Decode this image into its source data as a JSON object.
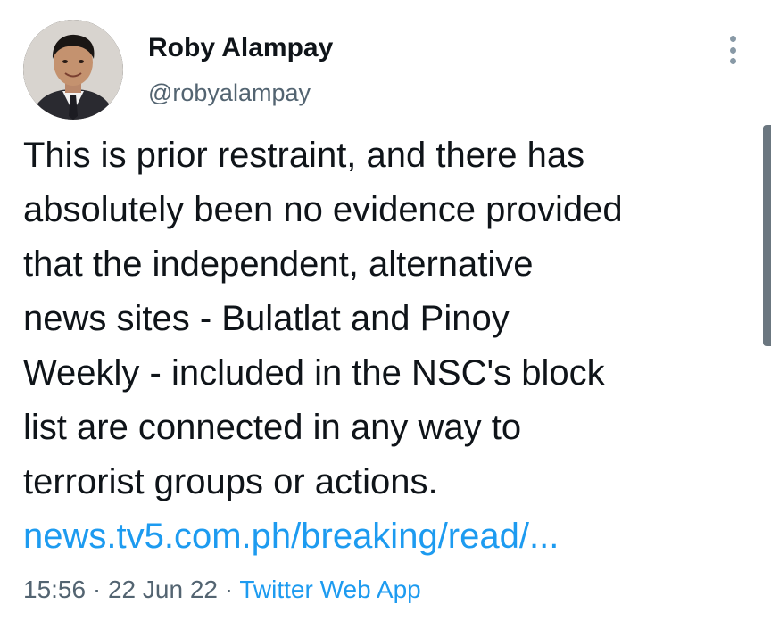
{
  "author": {
    "name": "Roby Alampay",
    "handle": "@robyalampay"
  },
  "tweet": {
    "lines": [
      "This is prior restraint, and there has",
      "absolutely been no evidence provided",
      "that the independent, alternative",
      "news sites - Bulatlat and Pinoy",
      "Weekly - included in the NSC's block",
      "list are connected in any way to",
      "terrorist groups or actions."
    ],
    "link": "news.tv5.com.ph/breaking/read/..."
  },
  "meta": {
    "time": "15:56",
    "separator": "·",
    "date": "22 Jun 22",
    "source": "Twitter Web App"
  },
  "icons": {
    "more": "more-options-icon",
    "avatar": "avatar"
  },
  "colors": {
    "text": "#0f1419",
    "secondary": "#536471",
    "link": "#1d9bf0"
  }
}
